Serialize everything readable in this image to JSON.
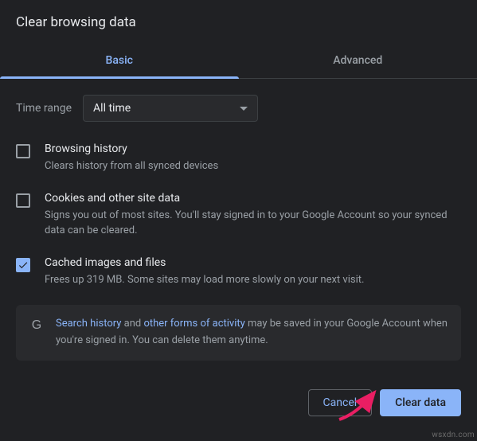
{
  "title": "Clear browsing data",
  "tabs": {
    "basic": "Basic",
    "advanced": "Advanced"
  },
  "time": {
    "label": "Time range",
    "value": "All time"
  },
  "options": [
    {
      "title": "Browsing history",
      "desc": "Clears history from all synced devices",
      "checked": false
    },
    {
      "title": "Cookies and other site data",
      "desc": "Signs you out of most sites. You'll stay signed in to your Google Account so your synced data can be cleared.",
      "checked": false
    },
    {
      "title": "Cached images and files",
      "desc": "Frees up 319 MB. Some sites may load more slowly on your next visit.",
      "checked": true
    }
  ],
  "info": {
    "link1": "Search history",
    "mid1": " and ",
    "link2": "other forms of activity",
    "rest": " may be saved in your Google Account when you're signed in. You can delete them anytime."
  },
  "buttons": {
    "cancel": "Cancel",
    "clear": "Clear data"
  },
  "watermark": "wsxdn.com",
  "colors": {
    "accent": "#8ab4f8",
    "bg": "#202124"
  }
}
